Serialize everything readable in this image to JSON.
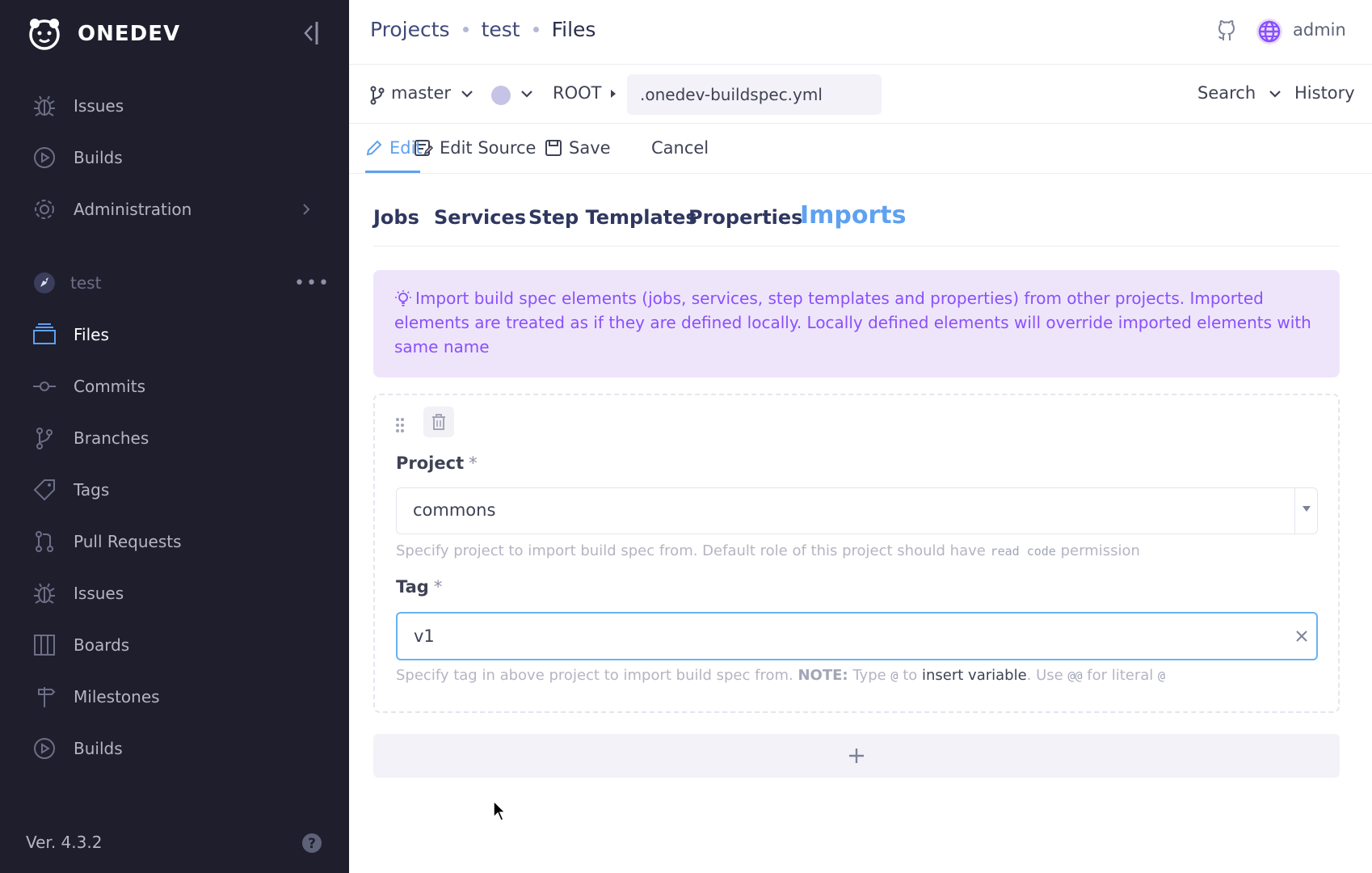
{
  "app": {
    "name": "ONEDEV",
    "version": "Ver. 4.3.2"
  },
  "sidebar": {
    "items": [
      {
        "label": "Issues",
        "icon": "bug-icon"
      },
      {
        "label": "Builds",
        "icon": "play-circle-icon"
      },
      {
        "label": "Administration",
        "icon": "gear-icon"
      }
    ],
    "project": {
      "label": "test",
      "icon": "rocket-icon"
    },
    "project_items": [
      {
        "label": "Files",
        "icon": "files-icon",
        "active": true
      },
      {
        "label": "Commits",
        "icon": "commit-icon"
      },
      {
        "label": "Branches",
        "icon": "branch-icon"
      },
      {
        "label": "Tags",
        "icon": "tag-icon"
      },
      {
        "label": "Pull Requests",
        "icon": "pull-request-icon"
      },
      {
        "label": "Issues",
        "icon": "bug-icon"
      },
      {
        "label": "Boards",
        "icon": "board-icon"
      },
      {
        "label": "Milestones",
        "icon": "milestone-icon"
      },
      {
        "label": "Builds",
        "icon": "play-circle-icon"
      }
    ]
  },
  "header": {
    "breadcrumbs": [
      "Projects",
      "test",
      "Files"
    ],
    "user": "admin"
  },
  "filebar": {
    "branch": "master",
    "root": "ROOT",
    "file_name": ".onedev-buildspec.yml",
    "search_label": "Search",
    "history_label": "History"
  },
  "edit_tabs": {
    "edit": "Edit",
    "edit_source": "Edit Source",
    "save": "Save",
    "cancel": "Cancel"
  },
  "section_tabs": [
    "Jobs",
    "Services",
    "Step Templates",
    "Properties",
    "Imports"
  ],
  "alert": {
    "text": "Import build spec elements (jobs, services, step templates and properties) from other projects. Imported elements are treated as if they are defined locally. Locally defined elements will override imported elements with same name"
  },
  "import_form": {
    "project_label": "Project",
    "required_mark": "*",
    "project_value": "commons",
    "project_help_pre": "Specify project to import build spec from. Default role of this project should have",
    "project_help_code": "read code",
    "project_help_post": "permission",
    "tag_label": "Tag",
    "tag_value": "v1",
    "tag_help_pre": "Specify tag in above project to import build spec from.",
    "tag_help_note": "NOTE:",
    "tag_help_type": "Type",
    "tag_help_at": "@",
    "tag_help_to": "to",
    "tag_help_link": "insert variable",
    "tag_help_use": ". Use",
    "tag_help_atat": "@@",
    "tag_help_literal": "for literal",
    "tag_help_at2": "@"
  },
  "colors": {
    "sidebar_bg": "#1e1e2d",
    "accent": "#5ea1f0",
    "alert_bg": "#efe5fb",
    "alert_text": "#8950fc"
  }
}
